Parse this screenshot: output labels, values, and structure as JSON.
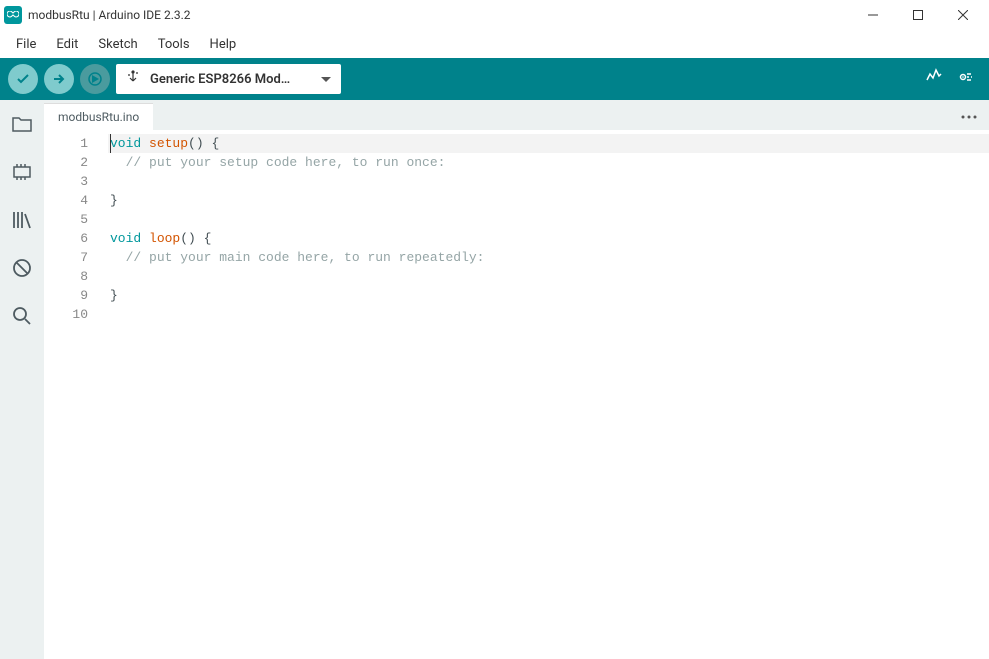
{
  "window": {
    "title": "modbusRtu | Arduino IDE 2.3.2"
  },
  "menubar": {
    "items": [
      "File",
      "Edit",
      "Sketch",
      "Tools",
      "Help"
    ]
  },
  "toolbar": {
    "board": "Generic ESP8266 Mod…"
  },
  "tabs": {
    "active": "modbusRtu.ino"
  },
  "code": {
    "lines": [
      {
        "n": 1,
        "tokens": [
          [
            "kw",
            "void"
          ],
          [
            "txt",
            " "
          ],
          [
            "fn",
            "setup"
          ],
          [
            "txt",
            "() {"
          ]
        ],
        "hl": true
      },
      {
        "n": 2,
        "tokens": [
          [
            "txt",
            "  "
          ],
          [
            "cmt",
            "// put your setup code here, to run once:"
          ]
        ]
      },
      {
        "n": 3,
        "tokens": []
      },
      {
        "n": 4,
        "tokens": [
          [
            "txt",
            "}"
          ]
        ]
      },
      {
        "n": 5,
        "tokens": []
      },
      {
        "n": 6,
        "tokens": [
          [
            "kw",
            "void"
          ],
          [
            "txt",
            " "
          ],
          [
            "fn",
            "loop"
          ],
          [
            "txt",
            "() {"
          ]
        ]
      },
      {
        "n": 7,
        "tokens": [
          [
            "txt",
            "  "
          ],
          [
            "cmt",
            "// put your main code here, to run repeatedly:"
          ]
        ]
      },
      {
        "n": 8,
        "tokens": []
      },
      {
        "n": 9,
        "tokens": [
          [
            "txt",
            "}"
          ]
        ]
      },
      {
        "n": 10,
        "tokens": []
      }
    ]
  }
}
